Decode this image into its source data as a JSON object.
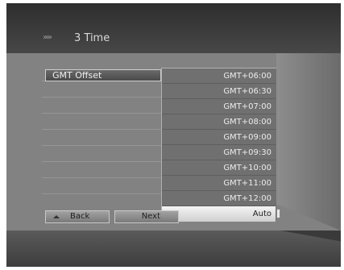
{
  "header": {
    "arrows": "›››››",
    "title": "3 Time"
  },
  "setting": {
    "label": "GMT Offset"
  },
  "dropdown": {
    "options": [
      "GMT+06:00",
      "GMT+06:30",
      "GMT+07:00",
      "GMT+08:00",
      "GMT+09:00",
      "GMT+09:30",
      "GMT+10:00",
      "GMT+11:00",
      "GMT+12:00",
      "Auto"
    ],
    "selected": "Auto"
  },
  "buttons": {
    "back": "Back",
    "next": "Next"
  },
  "icons": {
    "check": "check-icon",
    "back_arrow": "triangle-up-icon"
  }
}
